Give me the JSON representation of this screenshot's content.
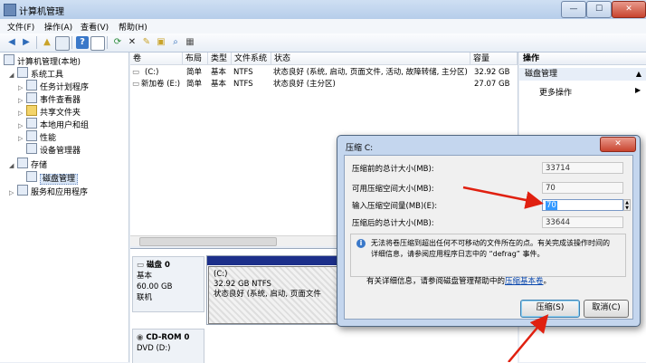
{
  "window": {
    "title": "计算机管理",
    "min_label": "—",
    "max_label": "☐",
    "close_label": "✕"
  },
  "menu": [
    "文件(F)",
    "操作(A)",
    "查看(V)",
    "帮助(H)"
  ],
  "toolbar_icons": [
    "back-icon",
    "forward-icon",
    "up-folder-icon",
    "show-tree-icon",
    "help-icon",
    "properties-icon",
    "refresh-icon",
    "delete-icon",
    "format-icon",
    "open-icon",
    "search-icon",
    "view-icon"
  ],
  "tree": [
    {
      "label": "计算机管理(本地)",
      "icon": "computer-icon"
    },
    {
      "label": "系统工具",
      "icon": "tools-icon"
    },
    {
      "label": "任务计划程序",
      "icon": "clock-icon"
    },
    {
      "label": "事件查看器",
      "icon": "event-icon"
    },
    {
      "label": "共享文件夹",
      "icon": "folder-icon"
    },
    {
      "label": "本地用户和组",
      "icon": "users-icon"
    },
    {
      "label": "性能",
      "icon": "performance-icon"
    },
    {
      "label": "设备管理器",
      "icon": "device-icon"
    },
    {
      "label": "存储",
      "icon": "storage-icon"
    },
    {
      "label": "磁盘管理",
      "icon": "disk-icon"
    },
    {
      "label": "服务和应用程序",
      "icon": "services-icon"
    }
  ],
  "columns": [
    "卷",
    "布局",
    "类型",
    "文件系统",
    "状态",
    "容量"
  ],
  "volumes": [
    {
      "name": "(C:)",
      "layout": "简单",
      "type": "基本",
      "fs": "NTFS",
      "status": "状态良好 (系统, 启动, 页面文件, 活动, 故障转储, 主分区)",
      "capacity": "32.92 GB"
    },
    {
      "name": "新加卷 (E:)",
      "layout": "简单",
      "type": "基本",
      "fs": "NTFS",
      "status": "状态良好 (主分区)",
      "capacity": "27.07 GB"
    }
  ],
  "disks": [
    {
      "name": "磁盘 0",
      "type": "基本",
      "size": "60.00 GB",
      "state": "联机",
      "part_name": "(C:)",
      "part_size": "32.92 GB NTFS",
      "part_status": "状态良好 (系统, 启动, 页面文件"
    },
    {
      "name": "CD-ROM 0",
      "type": "DVD (D:)"
    }
  ],
  "actions": {
    "header": "操作",
    "section": "磁盘管理",
    "more": "更多操作"
  },
  "dialog": {
    "title": "压缩 C:",
    "total_before_label": "压缩前的总计大小(MB):",
    "total_before": "33714",
    "available_label": "可用压缩空间大小(MB):",
    "available": "70",
    "input_label": "输入压缩空间量(MB)(E):",
    "input_value": "70",
    "total_after_label": "压缩后的总计大小(MB):",
    "total_after": "33644",
    "info_line1": "无法将卷压缩到超出任何不可移动的文件所在的点。有关完成该操作时间的",
    "info_line2": "详细信息，请参阅应用程序日志中的 “defrag” 事件。",
    "help_text": "有关详细信息，请参阅磁盘管理帮助中的",
    "help_link": "压缩基本卷",
    "help_end": "。",
    "ok_label": "压缩(S)",
    "cancel_label": "取消(C)"
  },
  "colors": {
    "annotation_arrow": "#e02010",
    "partition_bar": "#1c2f8a",
    "dialog_frame": "#c4d6ee"
  }
}
